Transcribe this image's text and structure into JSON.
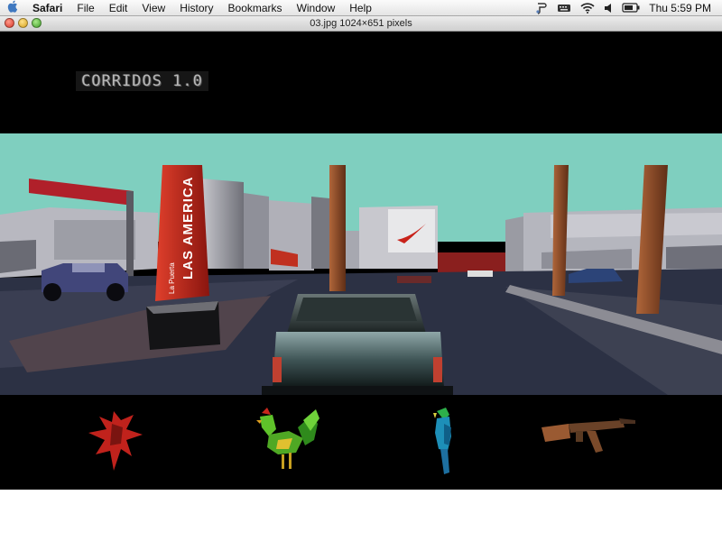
{
  "menubar": {
    "apple_icon": "apple-logo-icon",
    "app_name": "Safari",
    "items": [
      "File",
      "Edit",
      "View",
      "History",
      "Bookmarks",
      "Window",
      "Help"
    ],
    "tray_icons": [
      "script-menu-icon",
      "keyboard-icon",
      "wifi-icon",
      "volume-icon",
      "battery-icon"
    ],
    "clock": "Thu 5:59 PM"
  },
  "window": {
    "title": "03.jpg 1024×651 pixels"
  },
  "game": {
    "title": "CORRIDOS 1.0",
    "signs": {
      "pillar_vertical": "LAS AMERICA",
      "pillar_small": "La Puerta"
    },
    "inventory": [
      {
        "name": "red-figure-icon",
        "color": "#c0221c"
      },
      {
        "name": "rooster-icon",
        "color": "#5fc22a"
      },
      {
        "name": "parrot-icon",
        "color": "#1d8fb8"
      },
      {
        "name": "rifle-icon",
        "color": "#9a5a32"
      }
    ]
  },
  "colors": {
    "sky": "#7fcfbf",
    "road": "#252a3a",
    "pillar_red": "#c4281e",
    "pole_brown": "#8a4a28"
  }
}
